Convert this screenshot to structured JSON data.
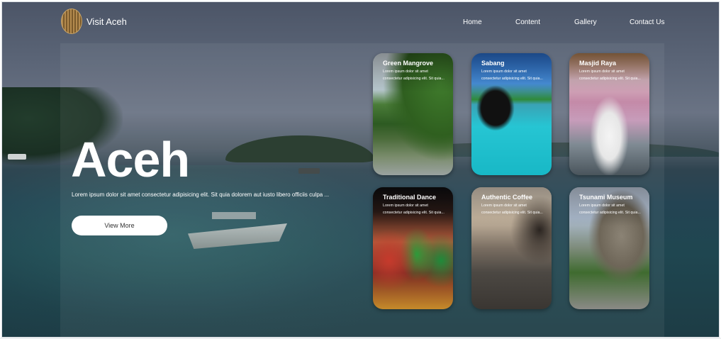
{
  "header": {
    "brand": "Visit Aceh",
    "nav": [
      "Home",
      "Content",
      "Gallery",
      "Contact Us"
    ]
  },
  "hero": {
    "title": "Aceh",
    "description": "Lorem ipsum dolor sit amet consectetur adipisicing elit. Sit quia dolorem aut iusto libero officiis culpa ...",
    "button_label": "View More"
  },
  "cards": [
    {
      "title": "Green Mangrove",
      "text": "Lorem ipsum dolor sit amet consectetur adipisicing elit. Sit quia..."
    },
    {
      "title": "Sabang",
      "text": "Lorem ipsum dolor sit amet consectetur adipisicing elit. Sit quia..."
    },
    {
      "title": "Masjid Raya",
      "text": "Lorem ipsum dolor sit amet consectetur adipisicing elit. Sit quia..."
    },
    {
      "title": "Traditional Dance",
      "text": "Lorem ipsum dolor sit amet consectetur adipisicing elit. Sit quia..."
    },
    {
      "title": "Authentic Coffee",
      "text": "Lorem ipsum dolor sit amet consectetur adipisicing elit. Sit quia..."
    },
    {
      "title": "Tsunami Museum",
      "text": "Lorem ipsum dolor sit amet consectetur adipisicing elit. Sit quia..."
    }
  ],
  "colors": {
    "text": "#ffffff",
    "button_bg": "#ffffff",
    "button_text": "#333333"
  }
}
